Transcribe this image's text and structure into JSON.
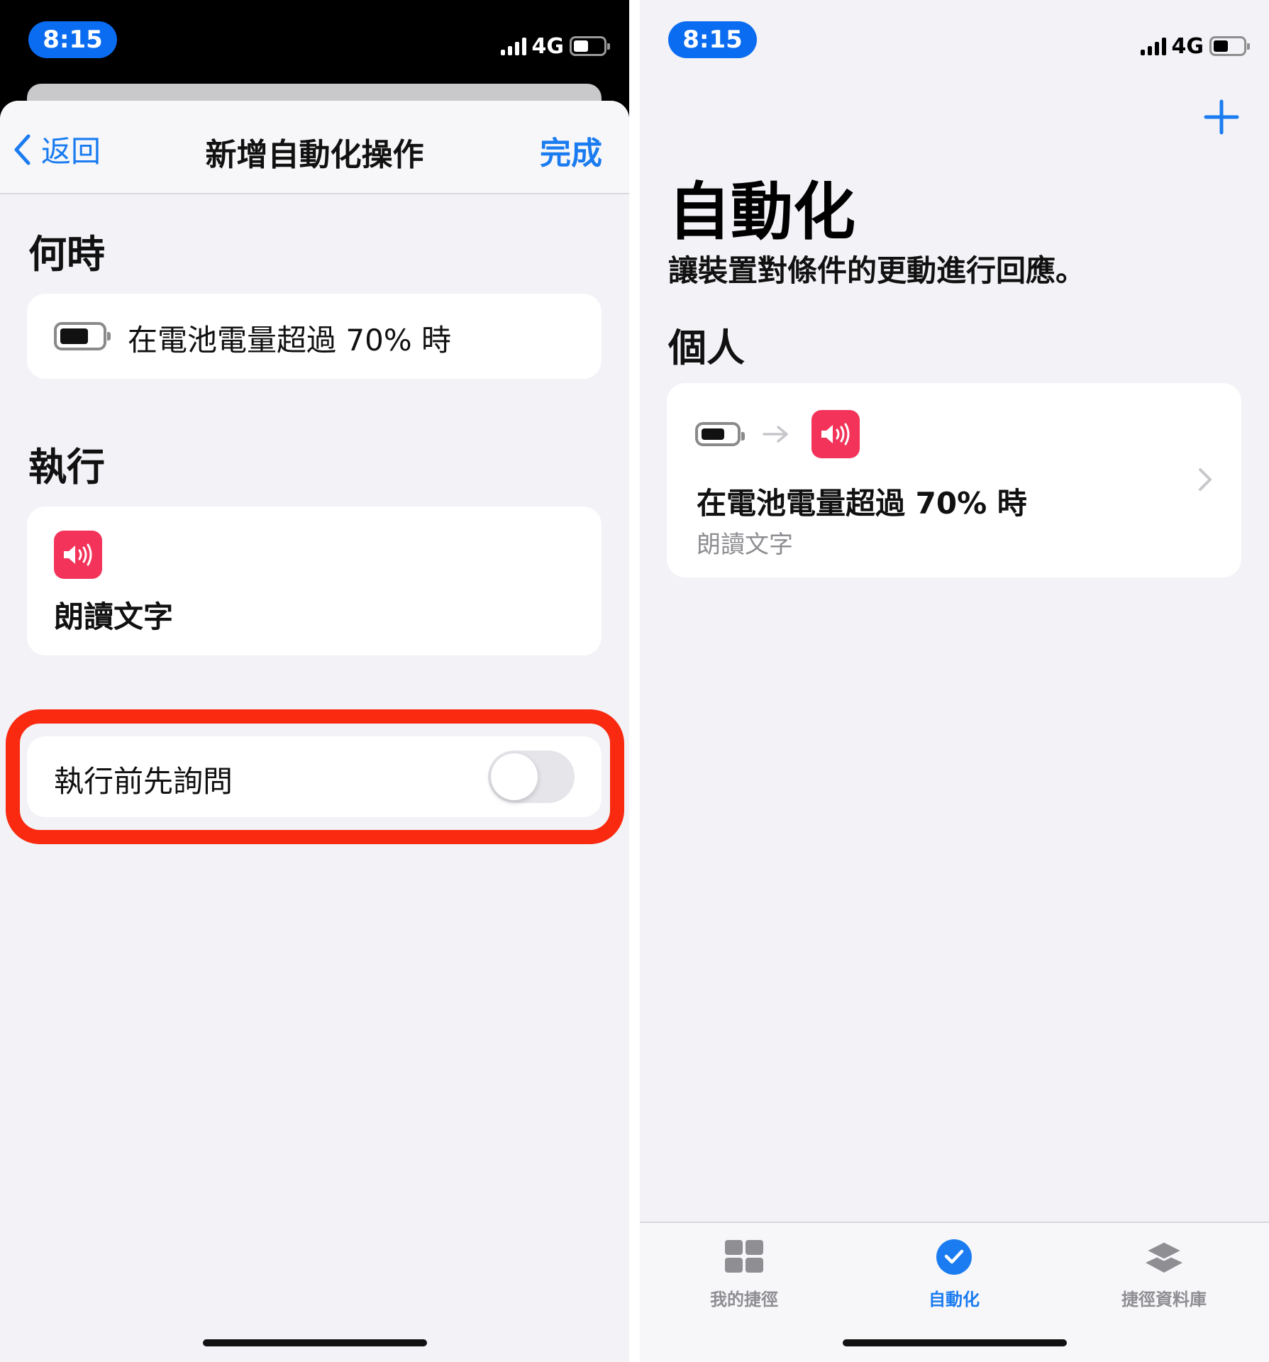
{
  "left": {
    "status": {
      "time": "8:15",
      "network": "4G"
    },
    "nav": {
      "back": "返回",
      "title": "新增自動化操作",
      "done": "完成"
    },
    "when": {
      "heading": "何時",
      "trigger": "在電池電量超過 70% 時"
    },
    "run": {
      "heading": "執行",
      "action": "朗讀文字"
    },
    "ask": {
      "label": "執行前先詢問",
      "enabled": false
    }
  },
  "right": {
    "status": {
      "time": "8:15",
      "network": "4G"
    },
    "title": "自動化",
    "subtitle": "讓裝置對條件的更動進行回應。",
    "section": "個人",
    "automation": {
      "trigger": "在電池電量超過 70% 時",
      "action": "朗讀文字"
    },
    "tabs": [
      {
        "label": "我的捷徑",
        "icon": "grid-icon",
        "active": false
      },
      {
        "label": "自動化",
        "icon": "automation-check-icon",
        "active": true
      },
      {
        "label": "捷徑資料庫",
        "icon": "layers-icon",
        "active": false
      }
    ]
  },
  "colors": {
    "accent": "#1a7cf0",
    "highlight": "#f92a0f",
    "speak_icon": "#f3335a",
    "tab_inactive": "#8e8e93"
  }
}
